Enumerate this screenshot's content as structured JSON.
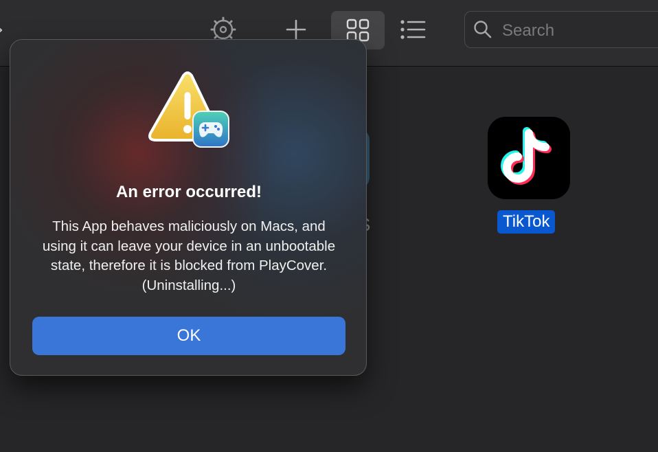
{
  "toolbar": {
    "icons": [
      "chevron-left-icon",
      "gear-icon",
      "plus-icon",
      "grid-view-icon",
      "list-view-icon",
      "search-icon"
    ],
    "search_placeholder": "Search"
  },
  "apps": [
    {
      "name": "S",
      "partially_hidden": true
    },
    {
      "name": "TikTok",
      "selected": true
    }
  ],
  "dialog": {
    "title": "An error occurred!",
    "message": "This App behaves maliciously on Macs, and using it can leave your device in an unbootable state, therefore it is blocked from PlayCover. (Uninstalling...)",
    "ok_label": "OK"
  },
  "colors": {
    "accent": "#3a75d8",
    "selection": "#0a58d0",
    "background": "#262628",
    "warning": "#f0c93c"
  }
}
